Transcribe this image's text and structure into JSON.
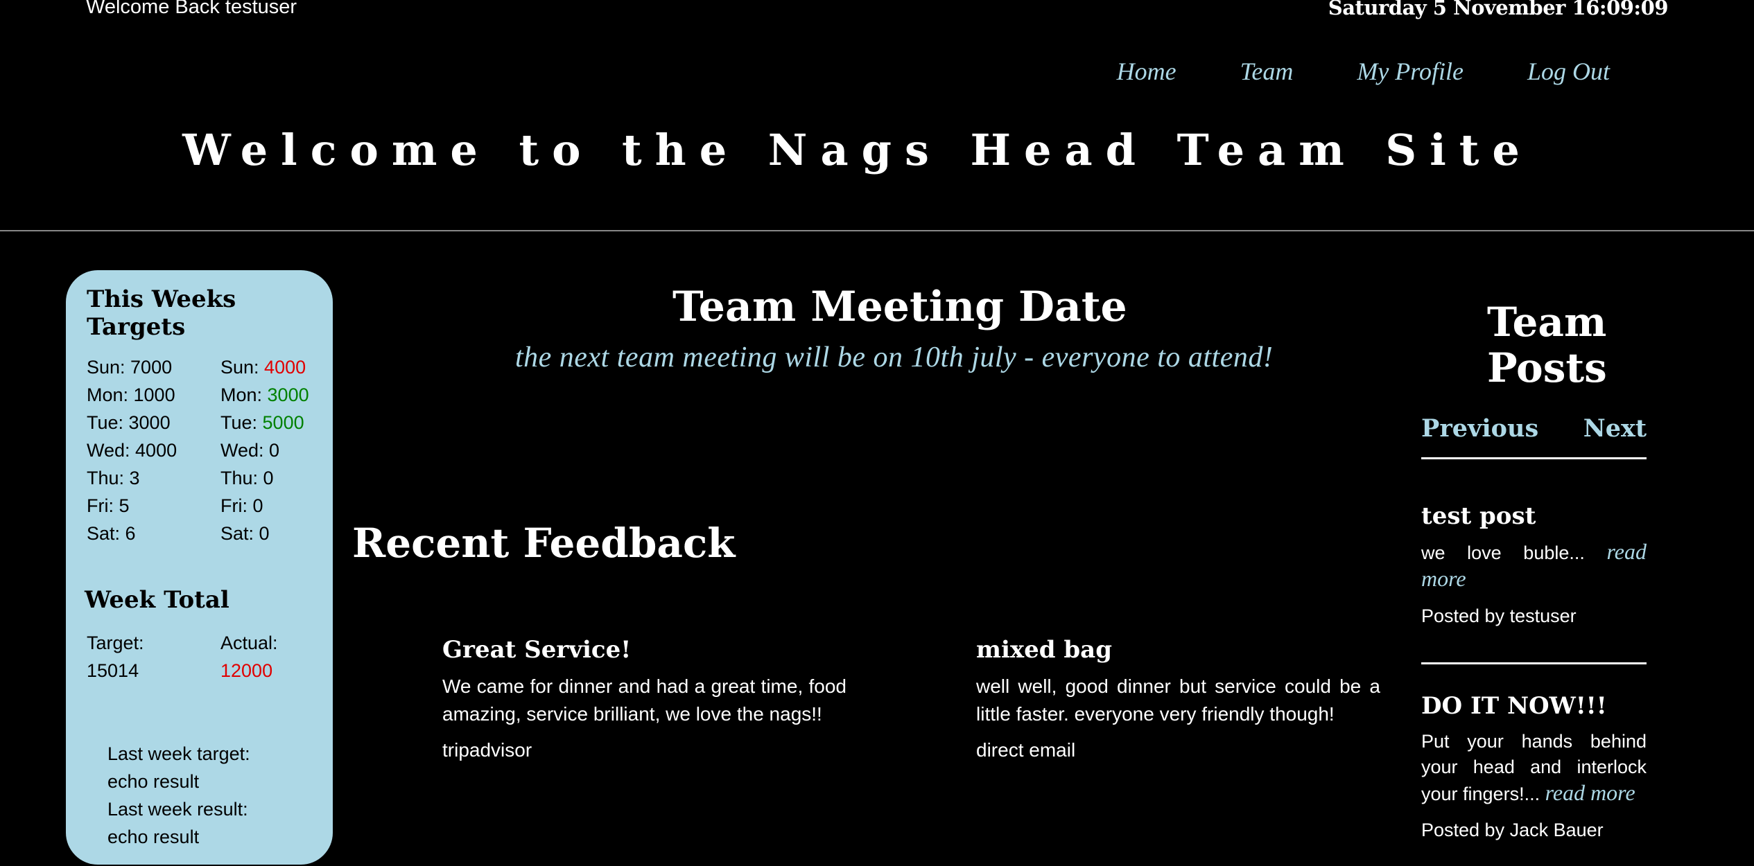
{
  "header": {
    "welcome": "Welcome Back testuser",
    "datetime": "Saturday 5 November 16:09:09",
    "title": "Welcome to the Nags Head Team Site"
  },
  "nav": {
    "items": [
      {
        "label": "Home"
      },
      {
        "label": "Team"
      },
      {
        "label": "My Profile"
      },
      {
        "label": "Log Out"
      }
    ]
  },
  "targets": {
    "heading": "This Weeks Targets",
    "target_days": [
      "Sun: 7000",
      "Mon: 1000",
      "Tue: 3000",
      "Wed: 4000",
      "Thu: 3",
      "Fri: 5",
      "Sat: 6"
    ],
    "actual_days": [
      {
        "label": "Sun: ",
        "value": "4000",
        "status": "red"
      },
      {
        "label": "Mon: ",
        "value": "3000",
        "status": "green"
      },
      {
        "label": "Tue: ",
        "value": "5000",
        "status": "green"
      },
      {
        "label": "Wed: ",
        "value": "0",
        "status": "none"
      },
      {
        "label": "Thu: ",
        "value": "0",
        "status": "none"
      },
      {
        "label": "Fri: ",
        "value": "0",
        "status": "none"
      },
      {
        "label": "Sat: ",
        "value": "0",
        "status": "none"
      }
    ],
    "total_heading": "Week Total",
    "target_label": "Target:",
    "target_value": "15014",
    "actual_label": "Actual:",
    "actual_value": "12000",
    "last_week_target_label": "Last week target:",
    "last_week_target_value": "echo result",
    "last_week_result_label": "Last week result:",
    "last_week_result_value": "echo result"
  },
  "meeting": {
    "title": "Team Meeting Date",
    "text": "the next team meeting will be on 10th july - everyone to attend!"
  },
  "feedback": {
    "title": "Recent Feedback",
    "items": [
      {
        "title": "Great Service!",
        "body": "We came for dinner and had a great time, food amazing, service brilliant, we love the nags!!",
        "source": "tripadvisor"
      },
      {
        "title": "mixed bag",
        "body": "well well, good dinner but service could be a little faster. everyone very friendly though!",
        "source": "direct email"
      }
    ]
  },
  "posts": {
    "title": "Team Posts",
    "previous": "Previous",
    "next": "Next",
    "items": [
      {
        "title": "test post",
        "excerpt": "we love buble...",
        "read_more": "read more",
        "byline": "Posted by testuser"
      },
      {
        "title": "DO IT NOW!!!",
        "excerpt": "Put your hands behind your head and interlock your fingers!...",
        "read_more": "read more",
        "byline": "Posted by Jack Bauer"
      }
    ]
  },
  "colors": {
    "background": "#000000",
    "accent": "#add8e6",
    "below_target": "#e00000",
    "above_target": "#008000"
  }
}
